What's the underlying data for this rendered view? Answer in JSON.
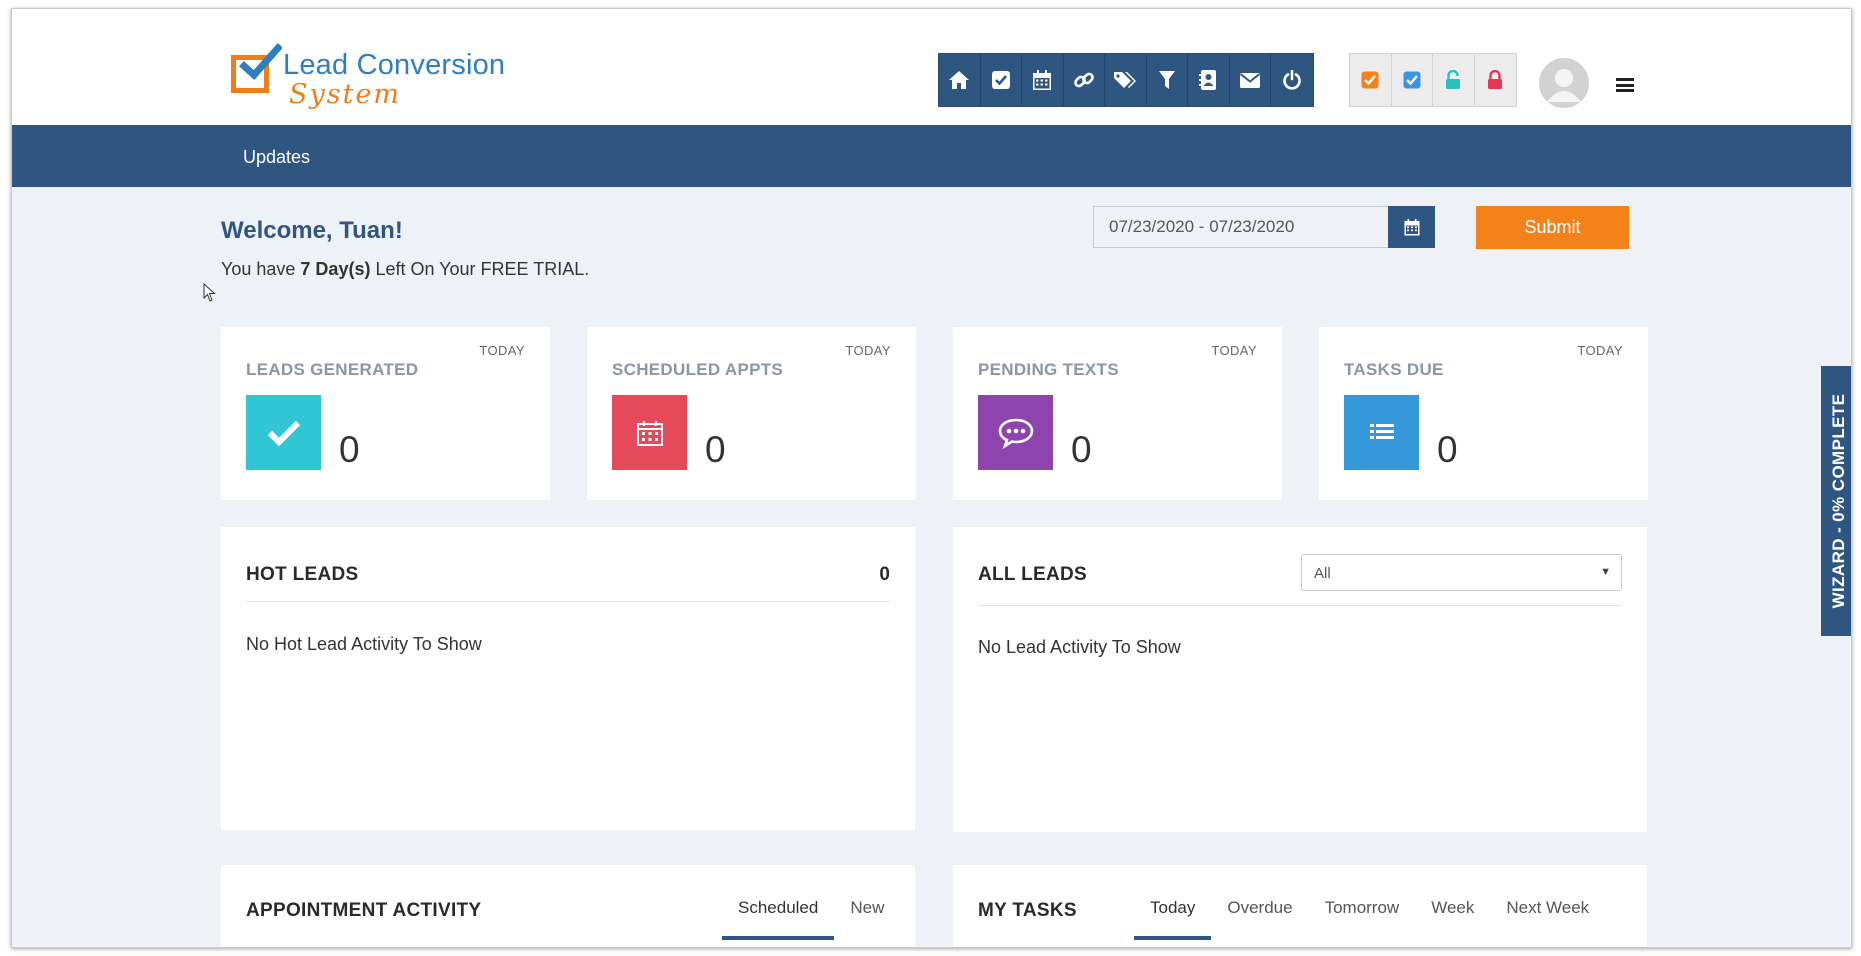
{
  "brand": {
    "name_line1": "Lead Conversion",
    "name_line2": "System",
    "accent_orange": "#f28219",
    "brand_blue": "#2e5681",
    "logo_blue": "#2f7ebd"
  },
  "toolbar": {
    "icons": [
      "home-icon",
      "check-square-icon",
      "calendar-icon",
      "link-icon",
      "tags-icon",
      "filter-icon",
      "contact-book-icon",
      "envelope-icon",
      "power-icon"
    ]
  },
  "status_toolbar": {
    "icons": [
      "orange-checkbox-icon",
      "blue-checkbox-icon",
      "teal-lock-icon",
      "red-lock-icon"
    ],
    "colors": [
      "#f28219",
      "#3b94e0",
      "#2bbfbf",
      "#e5384f"
    ]
  },
  "nav": {
    "updates": "Updates"
  },
  "welcome": {
    "greeting": "Welcome, Tuan!",
    "trial_prefix": "You have ",
    "trial_days": "7 Day(s)",
    "trial_suffix": " Left On Your FREE TRIAL."
  },
  "date_filter": {
    "range": "07/23/2020 - 07/23/2020",
    "submit": "Submit"
  },
  "stats": [
    {
      "label": "LEADS GENERATED",
      "period": "TODAY",
      "value": "0",
      "icon": "checkmark-icon",
      "color": "#31c6d3"
    },
    {
      "label": "SCHEDULED APPTS",
      "period": "TODAY",
      "value": "0",
      "icon": "calendar-icon",
      "color": "#e54a5a"
    },
    {
      "label": "PENDING TEXTS",
      "period": "TODAY",
      "value": "0",
      "icon": "chat-bubble-icon",
      "color": "#8e44ad"
    },
    {
      "label": "TASKS DUE",
      "period": "TODAY",
      "value": "0",
      "icon": "list-icon",
      "color": "#3498db"
    }
  ],
  "hot_leads": {
    "title": "HOT LEADS",
    "count": "0",
    "empty": "No Hot Lead Activity To Show"
  },
  "all_leads": {
    "title": "ALL LEADS",
    "filter": "All",
    "empty": "No Lead Activity To Show"
  },
  "appointments": {
    "title": "APPOINTMENT ACTIVITY",
    "tabs": [
      "Scheduled",
      "New"
    ],
    "active_tab": "Scheduled"
  },
  "my_tasks": {
    "title": "MY TASKS",
    "tabs": [
      "Today",
      "Overdue",
      "Tomorrow",
      "Week",
      "Next Week"
    ],
    "active_tab": "Today"
  },
  "wizard": {
    "label": "WIZARD - 0% COMPLETE"
  }
}
